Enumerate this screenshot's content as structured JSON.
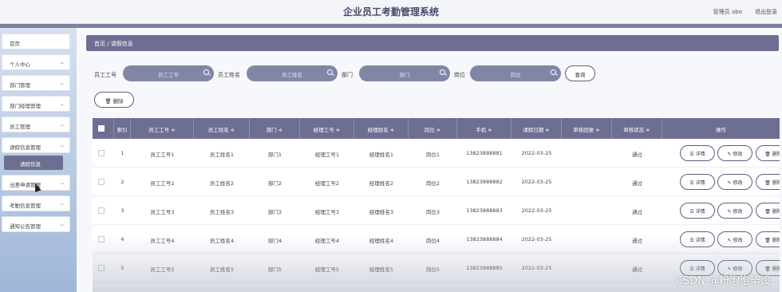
{
  "header": {
    "title": "企业员工考勤管理系统",
    "user": "管理员 abo",
    "logout": "退出登录"
  },
  "sidebar": {
    "items": [
      {
        "label": "首页",
        "has_chevron": false
      },
      {
        "label": "个人中心",
        "has_chevron": true
      },
      {
        "label": "部门管理",
        "has_chevron": true
      },
      {
        "label": "部门经理管理",
        "has_chevron": true
      },
      {
        "label": "员工管理",
        "has_chevron": true
      },
      {
        "label": "请假信息管理",
        "has_chevron": true
      },
      {
        "label": "出差申请管理",
        "has_chevron": true
      },
      {
        "label": "考勤信息管理",
        "has_chevron": true
      },
      {
        "label": "通知公告管理",
        "has_chevron": true
      }
    ],
    "active_sub": "请假信息"
  },
  "breadcrumb": "首页 / 请假信息",
  "filters": [
    {
      "label": "员工工号",
      "placeholder": "员工工号"
    },
    {
      "label": "员工姓名",
      "placeholder": "员工姓名"
    },
    {
      "label": "部门",
      "placeholder": "部门"
    },
    {
      "label": "岗位",
      "placeholder": "岗位"
    }
  ],
  "buttons": {
    "query": "查询",
    "delete": "删除"
  },
  "table": {
    "columns": [
      "索引",
      "员工工号 ≑",
      "员工姓名 ≑",
      "部门 ≑",
      "经理工号 ≑",
      "经理姓名 ≑",
      "岗位 ≑",
      "手机 ≑",
      "请假日期 ≑",
      "审核回复 ≑",
      "审核状态 ≑",
      "操作"
    ],
    "rows": [
      [
        "1",
        "员工工号1",
        "员工姓名1",
        "部门1",
        "经理工号1",
        "经理姓名1",
        "岗位1",
        "13823888881",
        "2022-03-25",
        "",
        "通过"
      ],
      [
        "2",
        "员工工号2",
        "员工姓名2",
        "部门2",
        "经理工号2",
        "经理姓名2",
        "岗位2",
        "13823888882",
        "2022-03-25",
        "",
        "通过"
      ],
      [
        "3",
        "员工工号3",
        "员工姓名3",
        "部门3",
        "经理工号3",
        "经理姓名3",
        "岗位3",
        "13823888883",
        "2022-03-25",
        "",
        "通过"
      ],
      [
        "4",
        "员工工号4",
        "员工姓名4",
        "部门4",
        "经理工号4",
        "经理姓名4",
        "岗位4",
        "13823888884",
        "2022-03-25",
        "",
        "通过"
      ],
      [
        "5",
        "员工工号5",
        "员工姓名5",
        "部门5",
        "经理工号5",
        "经理姓名5",
        "岗位5",
        "13823888885",
        "2022-03-25",
        "",
        "通过"
      ]
    ],
    "actions": [
      "详情",
      "修改",
      "删除"
    ]
  },
  "watermark": "CSDN @粉泡泡毕设",
  "colors": {
    "accent": "#6c6f91",
    "input_bg": "#8286a6",
    "sidebar_bg": "#c9d6ea"
  }
}
